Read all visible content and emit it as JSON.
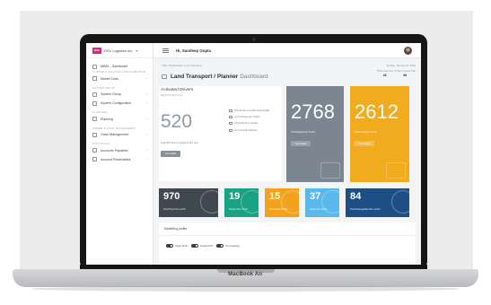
{
  "device": {
    "brand": "MacBook Air"
  },
  "sidebar": {
    "logo_text": "DSV",
    "company": "DSV Logistics Inc",
    "items": [
      {
        "label": "MIMS - Dashboard",
        "icon": "dashboard-icon"
      },
      {
        "section": "SYSTEM & MASTER CONFIGURATION"
      },
      {
        "label": "Master Data",
        "icon": "database-icon"
      },
      {
        "section": "SYSTEM SETUP"
      },
      {
        "label": "System Group",
        "icon": "group-icon"
      },
      {
        "label": "System Configuration",
        "icon": "config-icon"
      },
      {
        "section": "PLANNING"
      },
      {
        "label": "Planning",
        "icon": "planning-icon"
      },
      {
        "section": "ORDER & LOAD MANAGEMENT"
      },
      {
        "label": "Order Management",
        "icon": "order-icon"
      },
      {
        "section": "FINANCIALS"
      },
      {
        "label": "Accounts Payables",
        "icon": "payables-icon"
      },
      {
        "label": "Account Receivables",
        "icon": "receivables-icon"
      }
    ]
  },
  "topbar": {
    "greeting": "Hi, Sandeep Gupta"
  },
  "content": {
    "breadcrumb": "TMS  /  Dashboards  /  Land Transport...",
    "date": "Sunday, January 23, 2022",
    "title_main": "Land Transport / Planner",
    "title_sub": "Dashboard",
    "stats": [
      {
        "label": "TOTAL New Trips",
        "value": "46"
      },
      {
        "label": "TOTAL In Transit Trips",
        "value": "98"
      }
    ]
  },
  "active_drivers": {
    "title": "Activated Drivers",
    "subtitle": "Report for last 1 hour",
    "count": "520",
    "description": "Total 384 drivers registered this year",
    "button": "View details",
    "links": [
      "To know the complete Stop Details",
      "List of Drivers per Tractor",
      "List of Drivers in transit",
      "List of Inactive Drivers"
    ]
  },
  "tiles": [
    {
      "value": "2768",
      "label": "Total Registered Trucks",
      "button": "View details",
      "color": "#7c8690"
    },
    {
      "value": "2612",
      "label": "Total Available Trucks",
      "button": "View details",
      "color": "#f0ab1e"
    }
  ],
  "mini_stats": [
    {
      "value": "970",
      "label": "Total Trips this month",
      "color": "#3f4750"
    },
    {
      "value": "19",
      "label": "Routes this month",
      "color": "#1aa284"
    },
    {
      "value": "15",
      "label": "Incomplete PODs",
      "color": "#f3a21e"
    },
    {
      "value": "37",
      "label": "Stops this month",
      "color": "#5ab8ec"
    },
    {
      "value": "84",
      "label": "Total Downgrades this month",
      "color": "#1d4f86"
    }
  ],
  "marketing": {
    "title": "Marketing profits",
    "legend": [
      "Target Profit",
      "Actual Profit",
      "Over Highway"
    ]
  }
}
